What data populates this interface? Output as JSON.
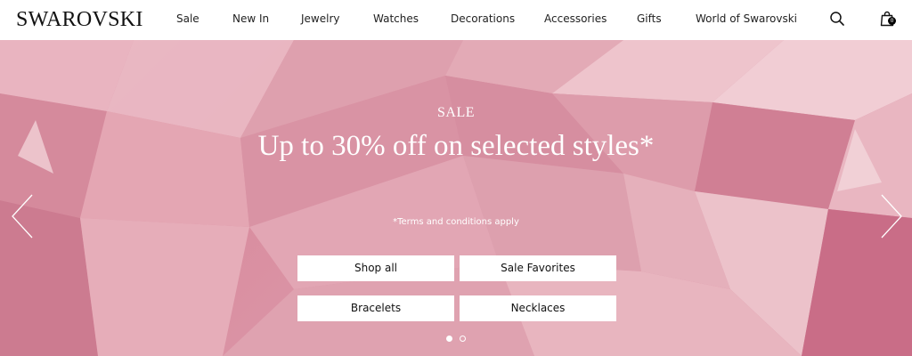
{
  "header": {
    "logo": "SWAROVSKI",
    "nav": [
      {
        "label": "Sale"
      },
      {
        "label": "New In"
      },
      {
        "label": "Jewelry"
      },
      {
        "label": "Watches"
      },
      {
        "label": "Decorations"
      },
      {
        "label": "Accessories"
      },
      {
        "label": "Gifts"
      },
      {
        "label": "World of Swarovski"
      }
    ],
    "icons": {
      "search": "search-icon",
      "bag": "shopping-bag-icon"
    },
    "bag_count": "0"
  },
  "hero": {
    "eyebrow": "SALE",
    "title": "Up to 30% off on selected styles*",
    "note": "*Terms and conditions apply",
    "buttons": [
      {
        "label": "Shop all"
      },
      {
        "label": "Sale Favorites"
      },
      {
        "label": "Bracelets"
      },
      {
        "label": "Necklaces"
      }
    ],
    "slides": {
      "total": 2,
      "active": 1
    },
    "colors": {
      "background": "#d98ea0",
      "text": "#ffffff"
    }
  }
}
